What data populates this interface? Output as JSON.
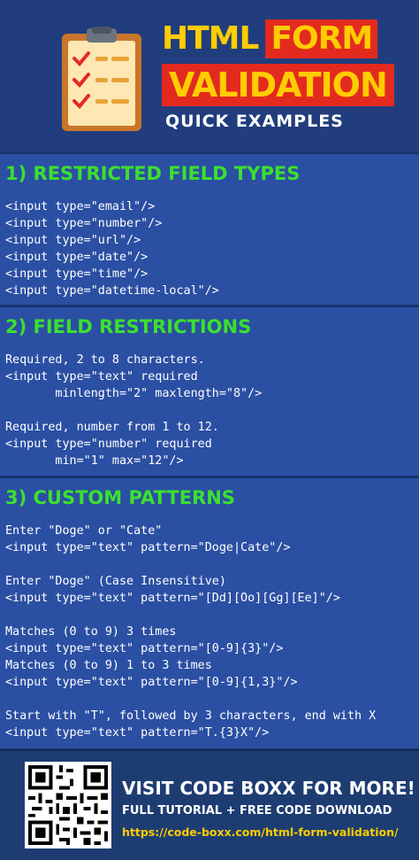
{
  "header": {
    "title_word1": "HTML",
    "title_word2": "FORM",
    "title_line2": "VALIDATION",
    "subtitle": "QUICK EXAMPLES",
    "logo_icon": "clipboard-checklist-icon"
  },
  "sections": [
    {
      "title": "1) RESTRICTED FIELD TYPES",
      "lines": [
        "<input type=\"email\"/>",
        "<input type=\"number\"/>",
        "<input type=\"url\"/>",
        "<input type=\"date\"/>",
        "<input type=\"time\"/>",
        "<input type=\"datetime-local\"/>"
      ]
    },
    {
      "title": "2) FIELD RESTRICTIONS",
      "lines": [
        "Required, 2 to 8 characters.",
        "<input type=\"text\" required",
        "       minlength=\"2\" maxlength=\"8\"/>",
        "",
        "Required, number from 1 to 12.",
        "<input type=\"number\" required",
        "       min=\"1\" max=\"12\"/>"
      ]
    },
    {
      "title": "3) CUSTOM PATTERNS",
      "lines": [
        "Enter \"Doge\" or \"Cate\"",
        "<input type=\"text\" pattern=\"Doge|Cate\"/>",
        "",
        "Enter \"Doge\" (Case Insensitive)",
        "<input type=\"text\" pattern=\"[Dd][Oo][Gg][Ee]\"/>",
        "",
        "Matches (0 to 9) 3 times",
        "<input type=\"text\" pattern=\"[0-9]{3}\"/>",
        "Matches (0 to 9) 1 to 3 times",
        "<input type=\"text\" pattern=\"[0-9]{1,3}\"/>",
        "",
        "Start with \"T\", followed by 3 characters, end with X",
        "<input type=\"text\" pattern=\"T.{3}X\"/>"
      ]
    }
  ],
  "footer": {
    "title": "VISIT CODE BOXX FOR MORE!",
    "subtitle": "FULL TUTORIAL + FREE CODE DOWNLOAD",
    "link": "https://code-boxx.com/html-form-validation/",
    "qr_icon": "qr-code-icon"
  },
  "colors": {
    "background": "#2b4fa3",
    "section_title": "#3ce02e",
    "accent_red": "#e42a1f",
    "accent_yellow": "#ffcc00"
  }
}
